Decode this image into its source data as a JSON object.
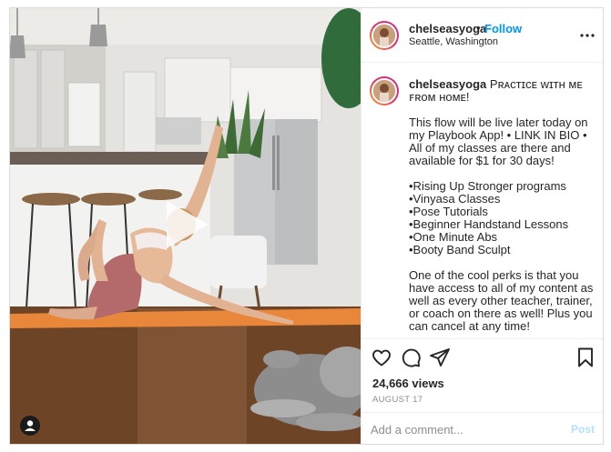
{
  "post": {
    "media": {
      "kind": "video",
      "play_icon": "play-icon",
      "user_tag_icon": "user-tag-icon"
    },
    "header": {
      "username": "chelseasyoga",
      "separator": "•",
      "follow_label": "Follow",
      "location": "Seattle, Washington",
      "more_icon": "more-horizontal-icon"
    },
    "caption": {
      "username": "chelseasyoga",
      "title": "Pʀᴀᴄᴛɪᴄᴇ ᴡɪᴛʜ ᴍᴇ ꜰʀᴏᴍ ʜᴏᴍᴇ!",
      "paragraph1": "This flow will be live later today on my Playbook App! • LINK IN BIO • All of my classes are there and available for $1 for 30 days!",
      "bullets": [
        "•Rising Up Stronger programs",
        "•Vinyasa Classes",
        "•Pose Tutorials",
        "•Beginner Handstand Lessons",
        "•One Minute Abs",
        "•Booty Band Sculpt"
      ],
      "paragraph2": "One of the cool perks is that you have access to all of my content as well as every other teacher, trainer, or coach on there as well! Plus you can cancel at any time!"
    },
    "actions": {
      "like_icon": "heart-icon",
      "comment_icon": "comment-icon",
      "share_icon": "paper-plane-icon",
      "save_icon": "bookmark-icon",
      "views": "24,666 views",
      "date": "AUGUST 17",
      "comment_placeholder": "Add a comment...",
      "post_label": "Post"
    },
    "colors": {
      "accent": "#0095f6",
      "post_disabled": "#b2dffc",
      "muted": "#8e8e8e",
      "border": "#dbdbdb",
      "yoga_mat": "#e8863a"
    }
  }
}
